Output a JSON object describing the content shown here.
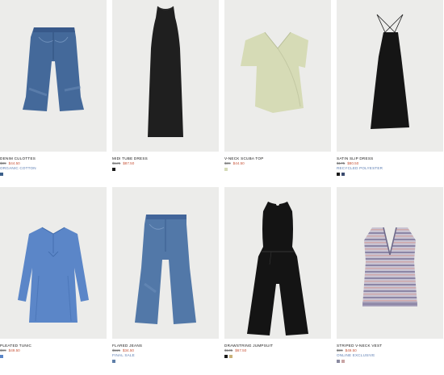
{
  "products": [
    {
      "name": "DENIM CULOTTES",
      "old_price": "$89",
      "sale_price": "$44.50",
      "tag": "ORGANIC COTTON",
      "swatches": [
        "#3c5f8a"
      ],
      "image_icon": "denim-culottes-image"
    },
    {
      "name": "MIDI TUBE DRESS",
      "old_price": "$125",
      "sale_price": "$87.50",
      "tag": "",
      "swatches": [
        "#1a1a1a"
      ],
      "image_icon": "midi-tube-dress-image"
    },
    {
      "name": "V-NECK SCUBA TOP",
      "old_price": "$89",
      "sale_price": "$44.50",
      "tag": "",
      "swatches": [
        "#d5dab8"
      ],
      "image_icon": "v-neck-scuba-top-image"
    },
    {
      "name": "SATIN SLIP DRESS",
      "old_price": "$175",
      "sale_price": "$80.50",
      "tag": "RECYCLED POLYESTER",
      "swatches": [
        "#1a1a1a",
        "#3a4a6e"
      ],
      "image_icon": "satin-slip-dress-image"
    },
    {
      "name": "PLEATED TUNIC",
      "old_price": "$99",
      "sale_price": "$49.50",
      "tag": "",
      "swatches": [
        "#5b86c8"
      ],
      "image_icon": "pleated-tunic-image"
    },
    {
      "name": "FLARED JEANS",
      "old_price": "$115",
      "sale_price": "$34.50",
      "tag": "FINAL SALE",
      "swatches": [
        "#5f7fa8"
      ],
      "image_icon": "flared-jeans-image"
    },
    {
      "name": "DRAWSTRING JUMPSUIT",
      "old_price": "$135",
      "sale_price": "$67.50",
      "tag": "",
      "swatches": [
        "#1a1a1a",
        "#c9b27a"
      ],
      "image_icon": "drawstring-jumpsuit-image"
    },
    {
      "name": "STRIPED V-NECK VEST",
      "old_price": "$99",
      "sale_price": "$49.50",
      "tag": "ONLINE EXCLUSIVE",
      "swatches": [
        "#8a8aa0",
        "#c9a5a5"
      ],
      "image_icon": "striped-vest-image"
    }
  ],
  "colors": {
    "image_bg": "#ececea",
    "sale": "#c8553a",
    "tag": "#5b7db3",
    "old_price": "#777777"
  }
}
